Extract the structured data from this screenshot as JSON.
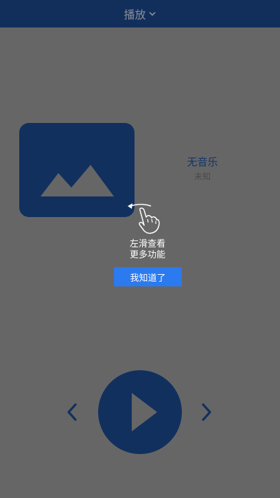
{
  "header": {
    "title": "播放",
    "dropdown_icon": "chevron-down-icon"
  },
  "cover": {
    "icon": "image-placeholder-icon"
  },
  "track": {
    "title": "无音乐",
    "artist": "未知"
  },
  "guide": {
    "icon": "swipe-left-hand-icon",
    "line1": "左滑查看",
    "line2": "更多功能",
    "button_label": "我知道了"
  },
  "controls": {
    "prev_icon": "chevron-left-icon",
    "play_icon": "play-icon",
    "next_icon": "chevron-right-icon"
  },
  "colors": {
    "overlay_background": "#666666",
    "header_background": "#122f5c",
    "primary_dark": "#11305e",
    "button_blue": "#2b7af0"
  }
}
